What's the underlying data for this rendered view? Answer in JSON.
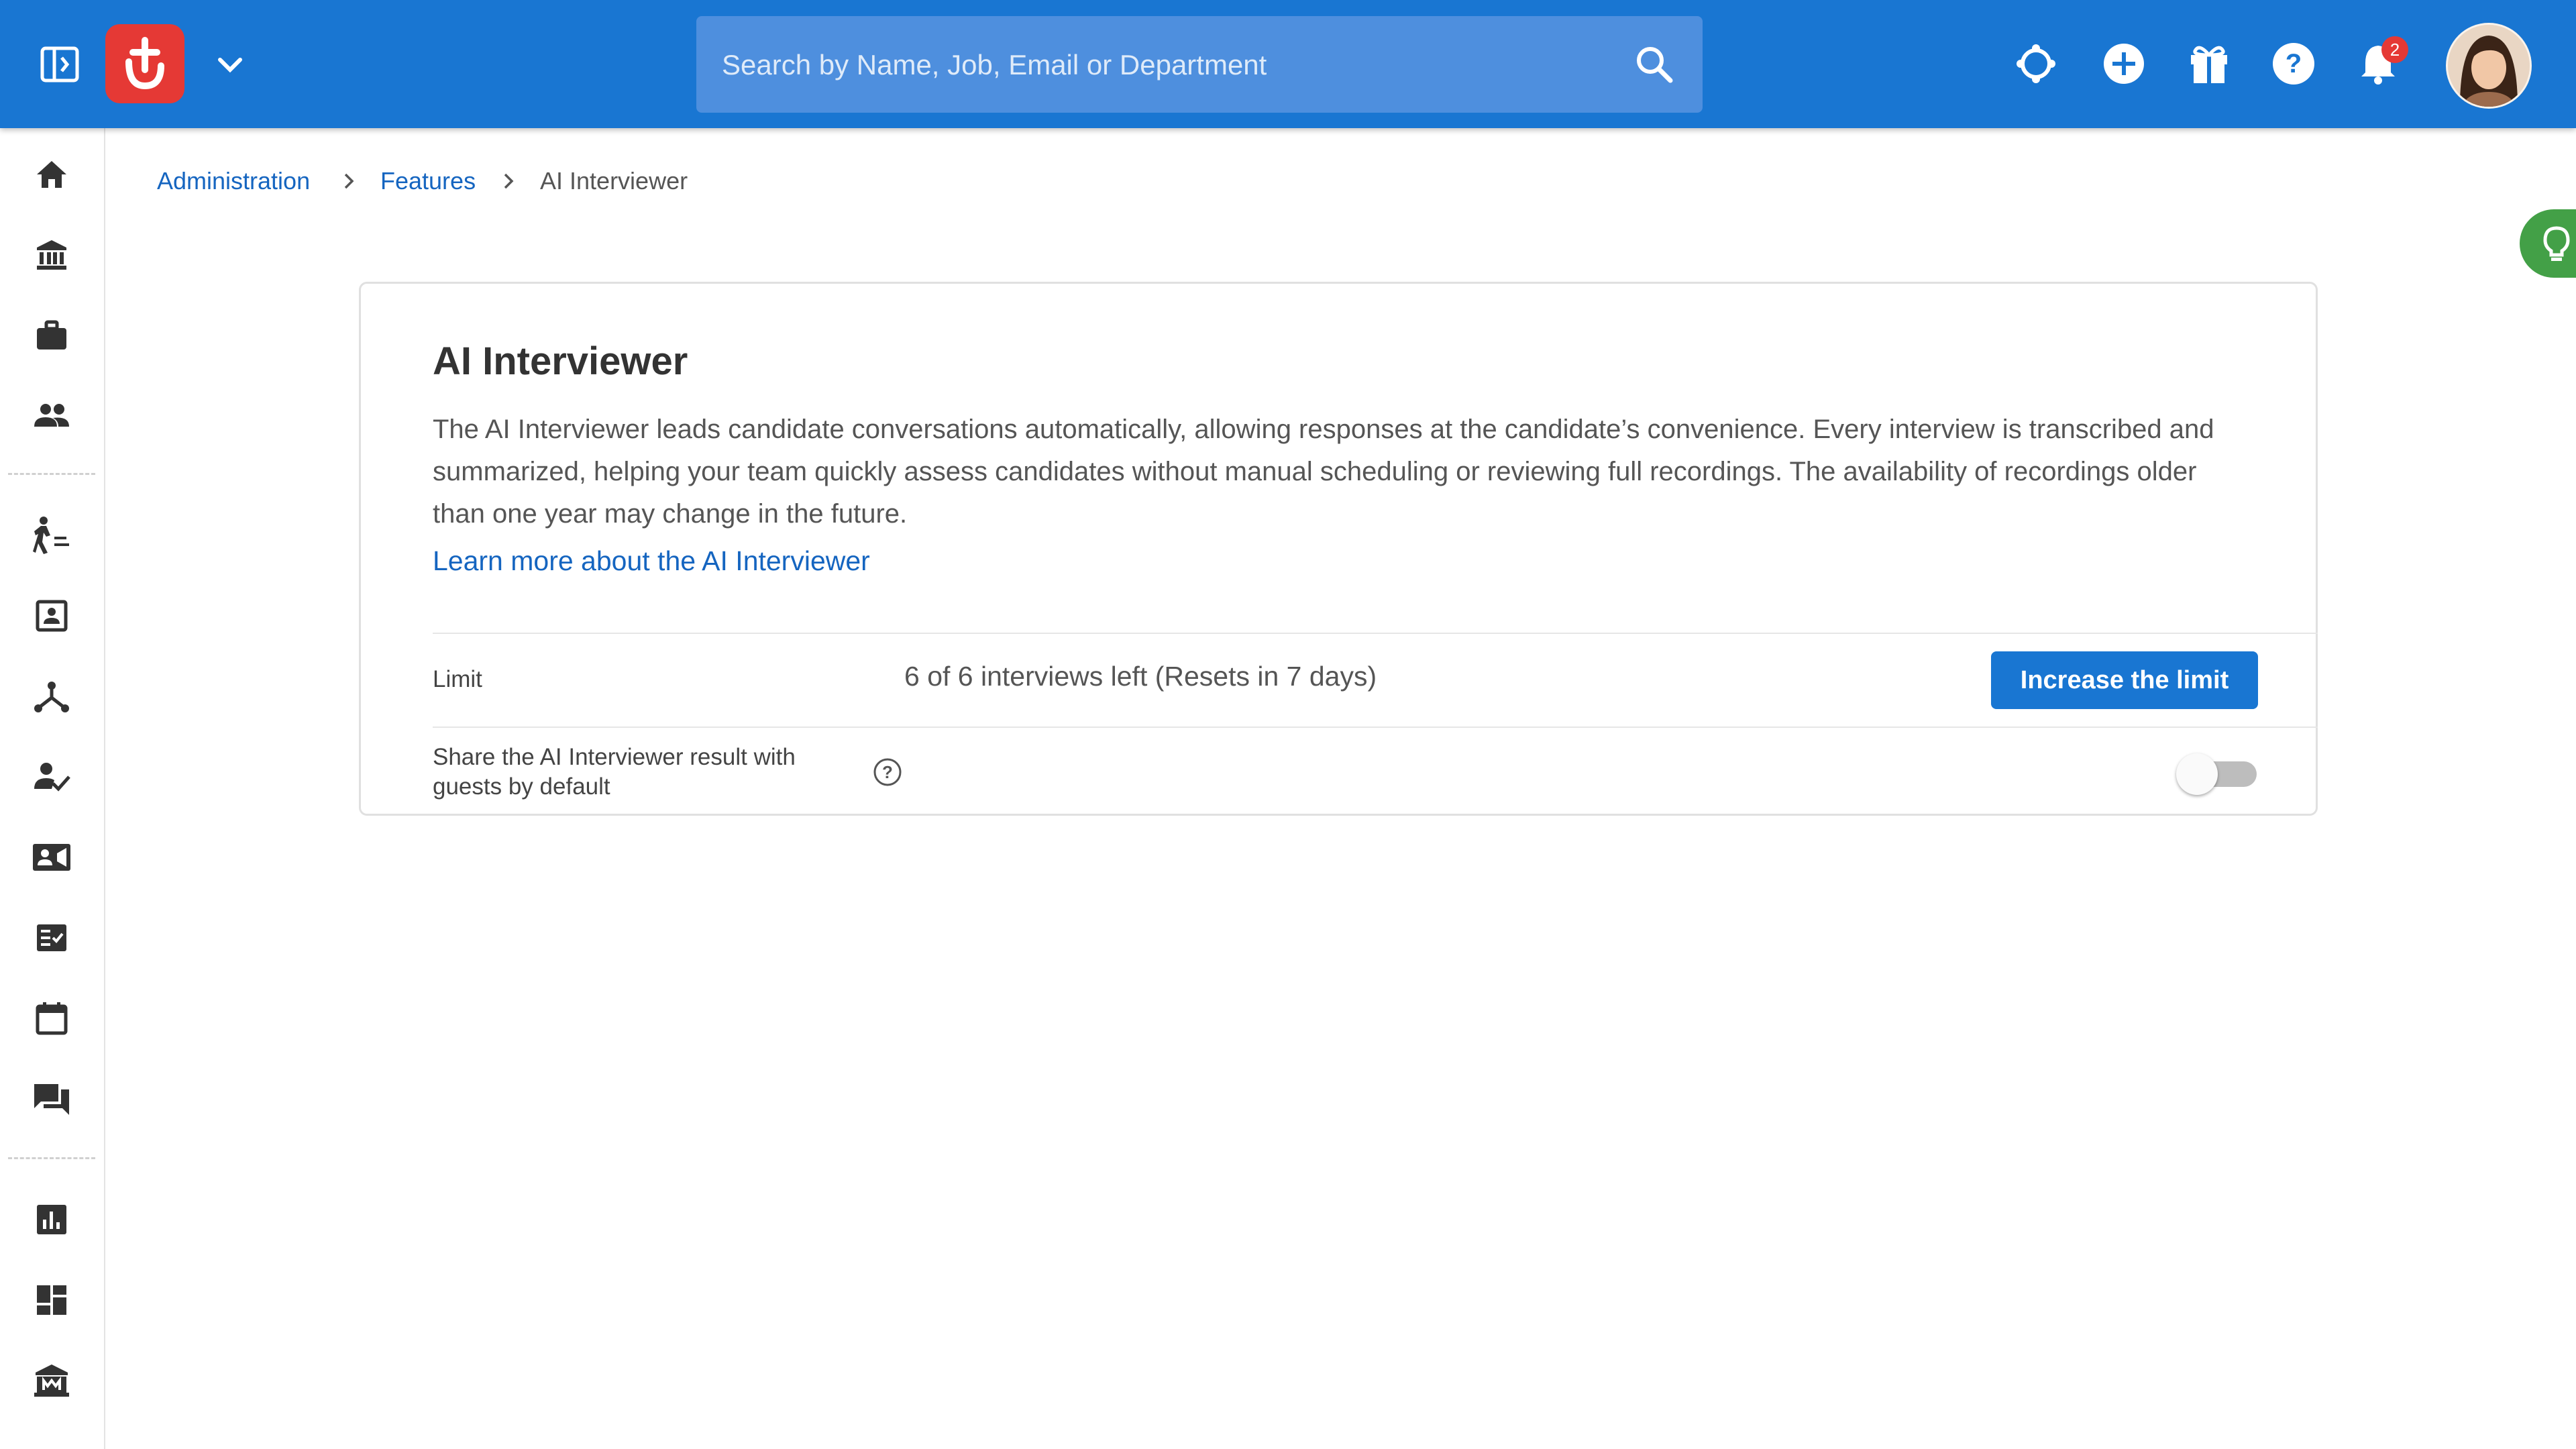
{
  "header": {
    "search_placeholder": "Search by Name, Job, Email or Department",
    "notification_count": "2",
    "brand_color": "#1976d2",
    "logo_color": "#e53935",
    "icons": [
      "panel-toggle-icon",
      "brand-logo",
      "chevron-down-icon",
      "search-icon",
      "integrations-icon",
      "add-circle-icon",
      "gift-icon",
      "help-icon",
      "bell-icon",
      "user-avatar"
    ]
  },
  "sidebar": {
    "icons": [
      "home-icon",
      "bank-icon",
      "briefcase-icon",
      "people-icon",
      "pipeline-icon",
      "contact-card-icon",
      "hierarchy-icon",
      "person-check-icon",
      "video-contact-icon",
      "checklist-icon",
      "calendar-icon",
      "chat-icon",
      "analytics-icon",
      "dashboard-icon",
      "marketplace-icon"
    ]
  },
  "breadcrumb": {
    "items": [
      "Administration",
      "Features",
      "AI Interviewer"
    ]
  },
  "card": {
    "title": "AI Interviewer",
    "description": "The AI Interviewer leads candidate conversations automatically, allowing responses at the candidate’s convenience. Every interview is transcribed and summarized, helping your team quickly assess candidates without manual scheduling or reviewing full recordings. The availability of recordings older than one year may change in the future.",
    "learn_more": "Learn more about the AI Interviewer",
    "limit": {
      "label": "Limit",
      "value": "6 of 6 interviews left (Resets in 7 days)",
      "button": "Increase the limit"
    },
    "share": {
      "label_line1": "Share the AI Interviewer result with",
      "label_line2": "guests by default",
      "enabled": false
    }
  },
  "tip_color": "#43a047"
}
